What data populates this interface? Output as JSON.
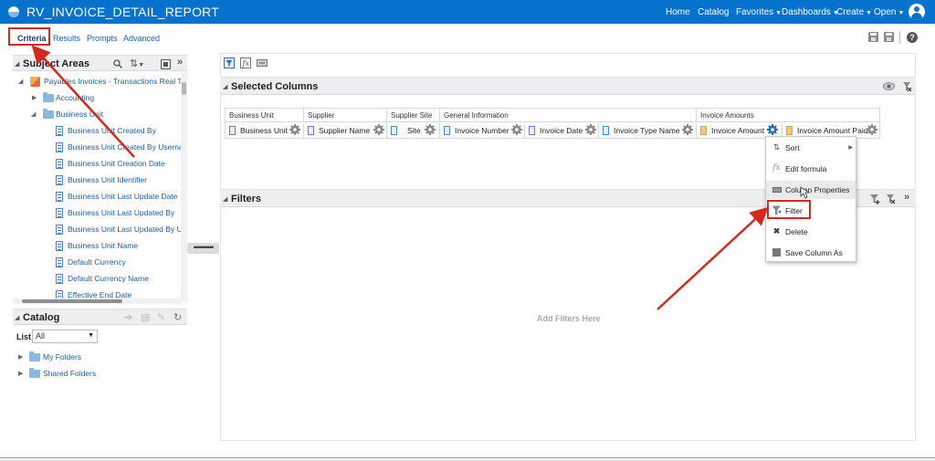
{
  "app": {
    "title": "RV_INVOICE_DETAIL_REPORT"
  },
  "nav": {
    "home": "Home",
    "catalog": "Catalog",
    "favorites": "Favorites",
    "dashboards": "Dashboards",
    "create": "Create",
    "open": "Open"
  },
  "tabs": {
    "criteria": "Criteria",
    "results": "Results",
    "prompts": "Prompts",
    "advanced": "Advanced"
  },
  "subject_areas": {
    "title": "Subject Areas",
    "root": "Payables Invoices - Transactions Real Time",
    "folders": {
      "accounting": "Accounting",
      "business_unit": "Business Unit"
    },
    "columns": [
      "Business Unit Created By",
      "Business Unit Created By Username",
      "Business Unit Creation Date",
      "Business Unit Identifier",
      "Business Unit Last Update Date",
      "Business Unit Last Updated By",
      "Business Unit Last Updated By Username",
      "Business Unit Name",
      "Default Currency",
      "Default Currency Name",
      "Effective End Date"
    ]
  },
  "catalog": {
    "title": "Catalog",
    "list_label": "List",
    "list_value": "All",
    "folders": {
      "my": "My Folders",
      "shared": "Shared Folders"
    }
  },
  "selected_columns": {
    "title": "Selected Columns",
    "groups": {
      "business_unit": "Business Unit",
      "supplier": "Supplier",
      "supplier_site": "Supplier Site",
      "general_information": "General Information",
      "invoice_amounts": "Invoice Amounts"
    },
    "columns": [
      "Business Unit",
      "Supplier Name",
      "Site",
      "Invoice Number",
      "Invoice Date",
      "Invoice Type Name",
      "Invoice Amount",
      "Invoice Amount Paid"
    ]
  },
  "filters": {
    "title": "Filters",
    "empty_text": "Add Filters Here"
  },
  "context_menu": {
    "sort": "Sort",
    "edit_formula": "Edit formula",
    "column_properties": "Column Properties",
    "filter": "Filter",
    "delete": "Delete",
    "save_column_as": "Save Column As"
  },
  "colors": {
    "header": "#0572ce",
    "annotation": "#d42a1e",
    "link": "#1a5fa8"
  }
}
